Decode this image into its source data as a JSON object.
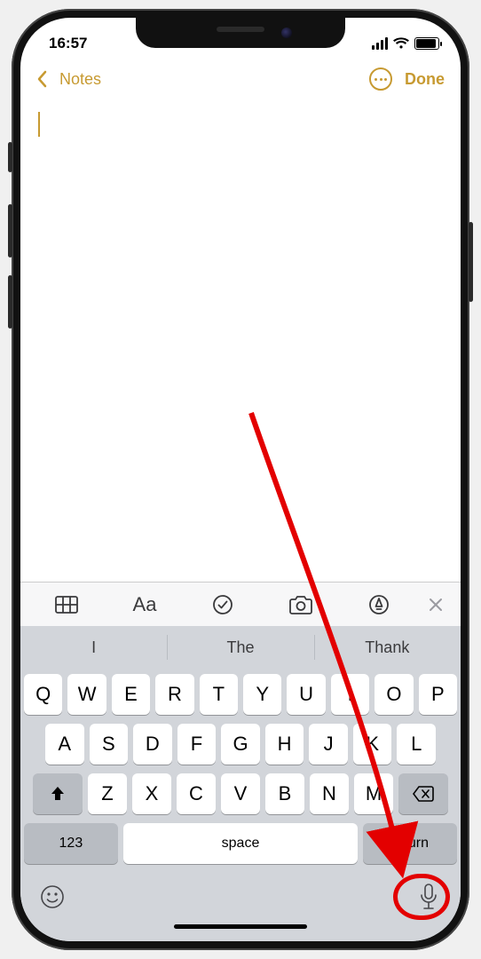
{
  "status": {
    "time": "16:57"
  },
  "nav": {
    "back_label": "Notes",
    "done_label": "Done"
  },
  "toolbar": {
    "table": "table-icon",
    "format": "Aa",
    "checklist": "check-icon",
    "camera": "camera-icon",
    "markup": "markup-icon"
  },
  "suggestions": [
    "I",
    "The",
    "Thank"
  ],
  "keys": {
    "row1": [
      "Q",
      "W",
      "E",
      "R",
      "T",
      "Y",
      "U",
      "I",
      "O",
      "P"
    ],
    "row2": [
      "A",
      "S",
      "D",
      "F",
      "G",
      "H",
      "J",
      "K",
      "L"
    ],
    "row3": [
      "Z",
      "X",
      "C",
      "V",
      "B",
      "N",
      "M"
    ],
    "numbers_label": "123",
    "space_label": "space",
    "return_label": "return"
  }
}
